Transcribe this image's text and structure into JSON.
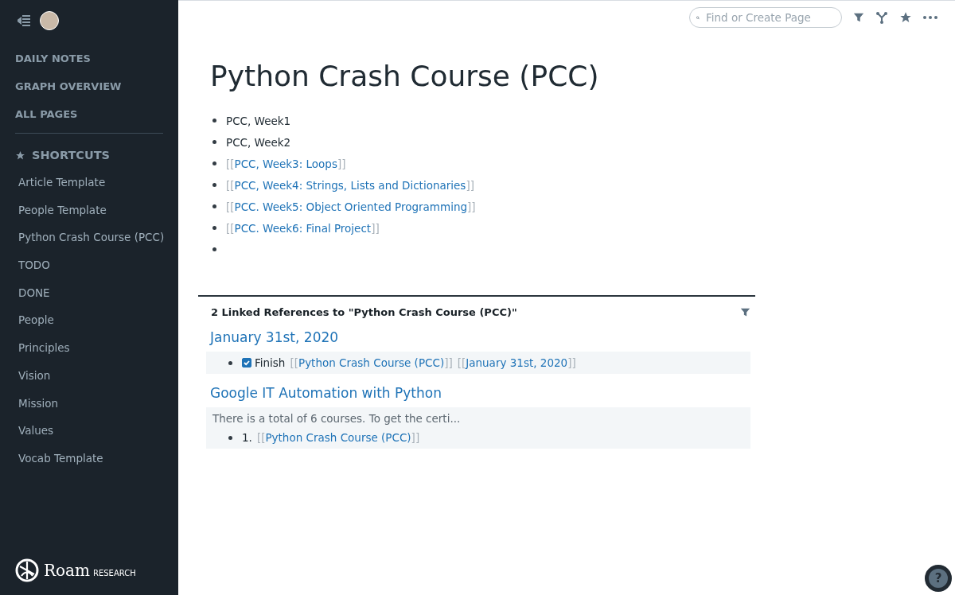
{
  "sidebar": {
    "nav": [
      "DAILY NOTES",
      "GRAPH OVERVIEW",
      "ALL PAGES"
    ],
    "shortcuts_title": "SHORTCUTS",
    "shortcuts": [
      "Article Template",
      "People Template",
      "Python Crash Course (PCC)",
      "TODO",
      "DONE",
      "People",
      "Principles",
      "Vision",
      "Mission",
      "Values",
      "Vocab Template"
    ],
    "logo": {
      "name": "Roam",
      "suffix": "RESEARCH"
    }
  },
  "topbar": {
    "search": {
      "placeholder": "Find or Create Page"
    }
  },
  "page": {
    "title": "Python Crash Course (PCC)",
    "bullets": [
      {
        "kind": "text",
        "text": "PCC, Week1"
      },
      {
        "kind": "text",
        "text": "PCC, Week2"
      },
      {
        "kind": "link",
        "open": "[[",
        "label": "PCC, Week3: Loops",
        "close": "]]"
      },
      {
        "kind": "link",
        "open": "[[",
        "label": "PCC, Week4: Strings, Lists and Dictionaries",
        "close": "]]"
      },
      {
        "kind": "link",
        "open": "[[",
        "label": "PCC. Week5: Object Oriented Programming",
        "close": "]]"
      },
      {
        "kind": "link",
        "open": "[[",
        "label": "PCC. Week6: Final Project",
        "close": "]]"
      },
      {
        "kind": "empty"
      }
    ]
  },
  "references": {
    "heading": "2 Linked References to \"Python Crash Course (PCC)\"",
    "groups": [
      {
        "title": "January 31st, 2020",
        "lines": [
          {
            "kind": "bullet",
            "parts": [
              {
                "kind": "checkbox",
                "checked": true
              },
              {
                "kind": "text",
                "text": "Finish"
              },
              {
                "kind": "link",
                "open": "[[",
                "label": "Python Crash Course (PCC)",
                "close": "]]"
              },
              {
                "kind": "link",
                "open": "[[",
                "label": "January 31st, 2020",
                "close": "]]"
              }
            ]
          }
        ]
      },
      {
        "title": "Google IT Automation with Python",
        "lines": [
          {
            "kind": "paragraph",
            "parts": [
              {
                "kind": "text",
                "text": "There is a total of 6 courses. To get the certi..."
              }
            ]
          },
          {
            "kind": "bullet",
            "parts": [
              {
                "kind": "text",
                "text": "1."
              },
              {
                "kind": "link",
                "open": "[[",
                "label": "Python Crash Course (PCC)",
                "close": "]]"
              }
            ]
          }
        ]
      }
    ]
  },
  "help": {
    "glyph": "?"
  }
}
